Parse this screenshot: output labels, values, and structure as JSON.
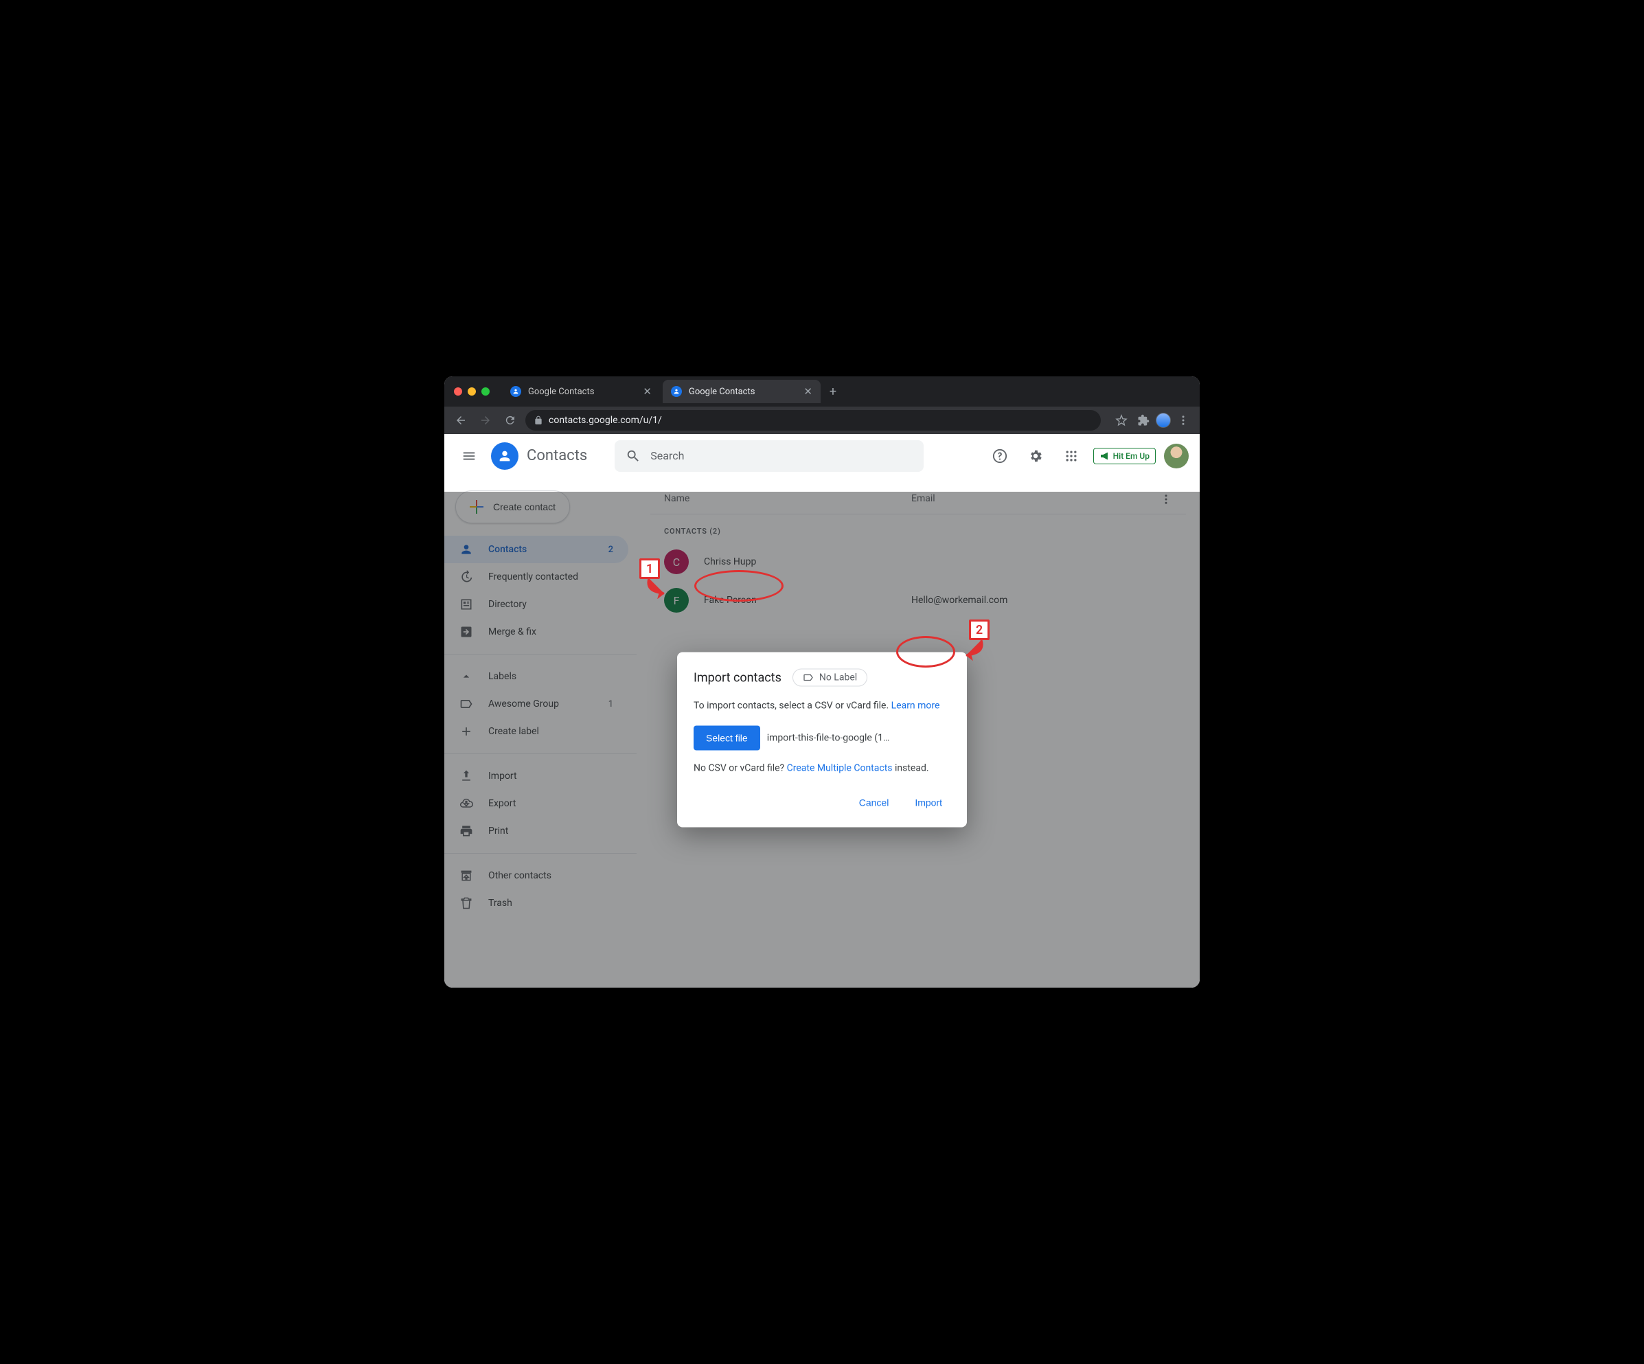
{
  "browser": {
    "tabs": [
      {
        "title": "Google Contacts",
        "active": false
      },
      {
        "title": "Google Contacts",
        "active": true
      }
    ],
    "url": "contacts.google.com/u/1/"
  },
  "header": {
    "app_title": "Contacts",
    "search_placeholder": "Search",
    "hitemup_label": "Hit Em Up"
  },
  "sidebar": {
    "create_label": "Create contact",
    "items": {
      "contacts": {
        "label": "Contacts",
        "badge": "2"
      },
      "frequent": {
        "label": "Frequently contacted"
      },
      "directory": {
        "label": "Directory"
      },
      "merge": {
        "label": "Merge & fix"
      },
      "labels_heading": "Labels",
      "label0": {
        "label": "Awesome Group",
        "badge": "1"
      },
      "create_label": {
        "label": "Create label"
      },
      "import": {
        "label": "Import"
      },
      "export": {
        "label": "Export"
      },
      "print": {
        "label": "Print"
      },
      "other": {
        "label": "Other contacts"
      },
      "trash": {
        "label": "Trash"
      }
    }
  },
  "main": {
    "col_name": "Name",
    "col_email": "Email",
    "section_heading": "CONTACTS (2)",
    "contacts": [
      {
        "initial": "C",
        "color": "#c2185b",
        "name": "Chriss Hupp",
        "email": ""
      },
      {
        "initial": "F",
        "color": "#0b8043",
        "name": "Fake Person",
        "email": "Hello@workemail.com"
      }
    ]
  },
  "modal": {
    "title": "Import contacts",
    "no_label": "No Label",
    "help_text_prefix": "To import contacts, select a CSV or vCard file. ",
    "help_link": "Learn more",
    "select_file_label": "Select file",
    "file_name": "import-this-file-to-google (1…",
    "nocsv_prefix": "No CSV or vCard file? ",
    "nocsv_link": "Create Multiple Contacts",
    "nocsv_suffix": " instead.",
    "cancel": "Cancel",
    "import": "Import"
  },
  "annotations": {
    "one": "1",
    "two": "2"
  }
}
